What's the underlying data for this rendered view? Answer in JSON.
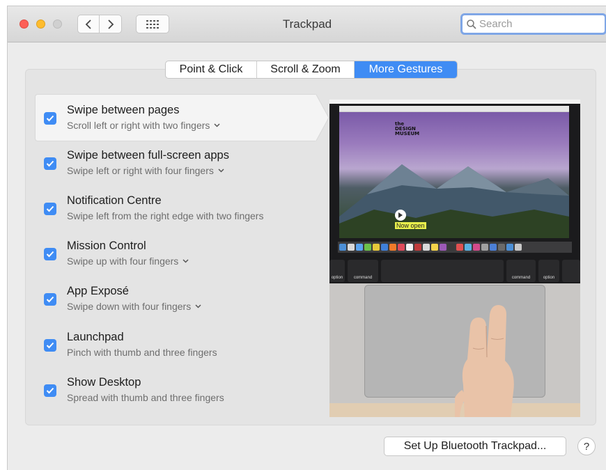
{
  "window": {
    "title": "Trackpad"
  },
  "search": {
    "placeholder": "Search"
  },
  "tabs": [
    {
      "label": "Point & Click",
      "selected": false
    },
    {
      "label": "Scroll & Zoom",
      "selected": false
    },
    {
      "label": "More Gestures",
      "selected": true
    }
  ],
  "gestures": [
    {
      "title": "Swipe between pages",
      "subtitle": "Scroll left or right with two fingers",
      "checked": true,
      "dropdown": true,
      "selected": true
    },
    {
      "title": "Swipe between full-screen apps",
      "subtitle": "Swipe left or right with four fingers",
      "checked": true,
      "dropdown": true
    },
    {
      "title": "Notification Centre",
      "subtitle": "Swipe left from the right edge with two fingers",
      "checked": true,
      "dropdown": false
    },
    {
      "title": "Mission Control",
      "subtitle": "Swipe up with four fingers",
      "checked": true,
      "dropdown": true
    },
    {
      "title": "App Exposé",
      "subtitle": "Swipe down with four fingers",
      "checked": true,
      "dropdown": true
    },
    {
      "title": "Launchpad",
      "subtitle": "Pinch with thumb and three fingers",
      "checked": true,
      "dropdown": false
    },
    {
      "title": "Show Desktop",
      "subtitle": "Spread with thumb and three fingers",
      "checked": true,
      "dropdown": false
    }
  ],
  "preview": {
    "logo": [
      "the",
      "DESIGN",
      "MUSEUM"
    ],
    "banner": "Now open",
    "keys": {
      "option": "option",
      "command": "command",
      "cmd_glyph": "⌘",
      "alt_glyph": "alt"
    }
  },
  "footer": {
    "setup_label": "Set Up Bluetooth Trackpad...",
    "help_label": "?"
  },
  "colors": {
    "accent": "#3f8cf4",
    "close": "#fd5f57",
    "minimize": "#febc2e"
  }
}
